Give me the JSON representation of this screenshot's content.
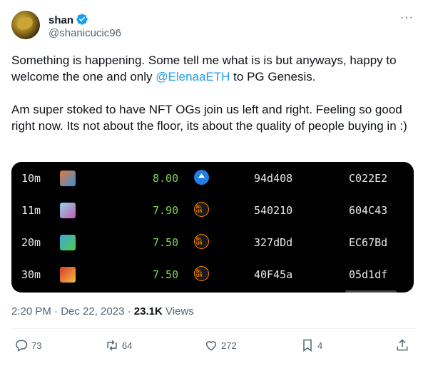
{
  "author": {
    "name": "shan",
    "handle": "@shanicucic96",
    "verified_icon": "verified-badge-icon",
    "more_label": "···"
  },
  "tweet": {
    "para1_pre": "Something is happening. Some tell me what is is but anyways, happy to welcome the one and only ",
    "mention": "@ElenaaETH",
    "para1_post": " to PG Genesis.",
    "para2": "Am super stoked to have NFT OGs join us left and right. Feeling so good right now. Its not about the floor, its about the quality of people buying in :)"
  },
  "media_table": {
    "rows": [
      {
        "time": "10m",
        "price": "8.00",
        "marketplace_icon": "opensea-icon",
        "from": "94d408",
        "to": "C022E2"
      },
      {
        "time": "11m",
        "price": "7.90",
        "marketplace_icon": "blur-icon",
        "from": "540210",
        "to": "604C43"
      },
      {
        "time": "20m",
        "price": "7.50",
        "marketplace_icon": "blur-icon",
        "from": "327dDd",
        "to": "EC67Bd"
      },
      {
        "time": "30m",
        "price": "7.50",
        "marketplace_icon": "blur-icon",
        "from": "40F45a",
        "to": "05d1df"
      }
    ]
  },
  "meta": {
    "timestamp": "2:20 PM · Dec 22, 2023 · ",
    "views_count": "23.1K",
    "views_label": " Views"
  },
  "actions": {
    "replies": "73",
    "reposts": "64",
    "likes": "272",
    "bookmarks": "4"
  },
  "colors": {
    "accent": "#1d9bf0",
    "price_green": "#7ed957",
    "secondary_text": "#536471"
  }
}
